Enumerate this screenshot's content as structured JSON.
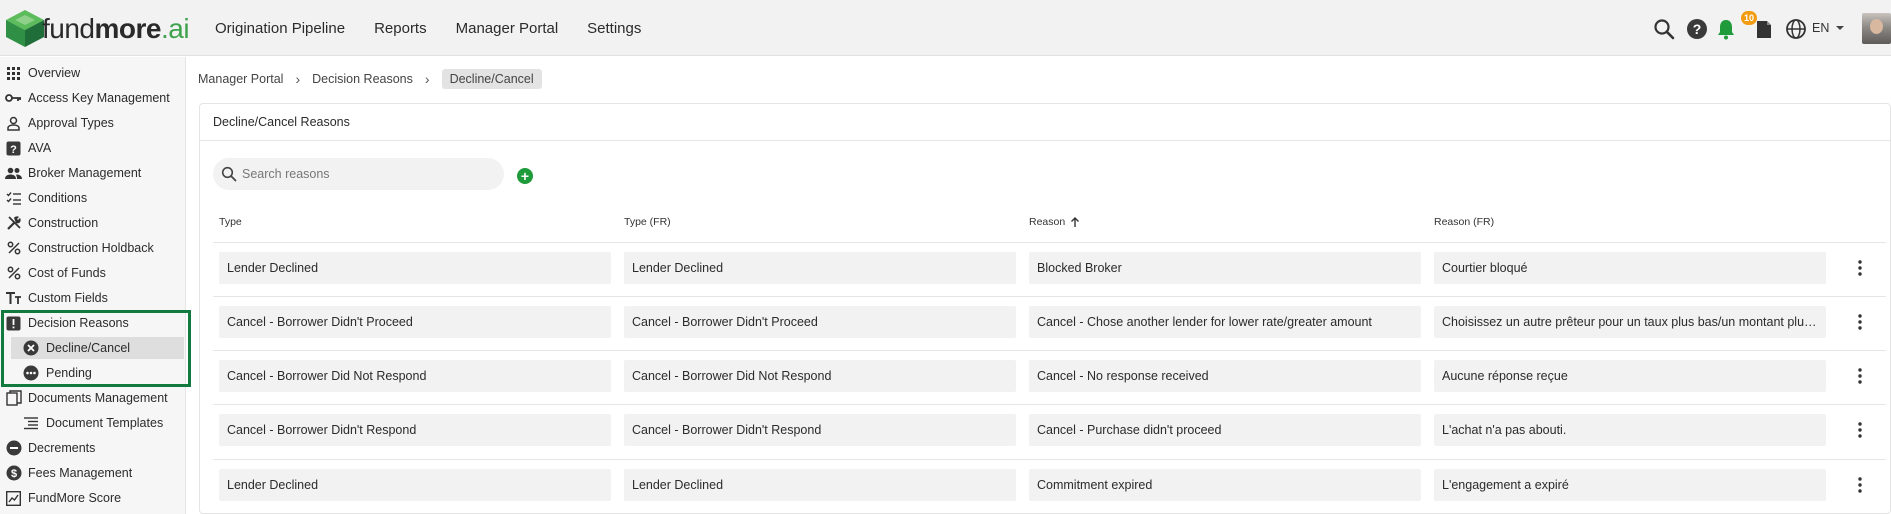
{
  "brand": {
    "name_light": "fund",
    "name_bold": "more",
    "name_suffix": ".ai",
    "accent": "#3fa34d",
    "highlight": "#127a3f"
  },
  "topnav": {
    "items": [
      "Origination Pipeline",
      "Reports",
      "Manager Portal",
      "Settings"
    ]
  },
  "topright": {
    "notification_count": "10",
    "language": "EN"
  },
  "sidebar": {
    "items": [
      {
        "label": "Overview",
        "icon": "grid-icon"
      },
      {
        "label": "Access Key Management",
        "icon": "key-icon"
      },
      {
        "label": "Approval Types",
        "icon": "person-icon"
      },
      {
        "label": "AVA",
        "icon": "question-box-icon"
      },
      {
        "label": "Broker Management",
        "icon": "people-icon"
      },
      {
        "label": "Conditions",
        "icon": "checklist-icon"
      },
      {
        "label": "Construction",
        "icon": "tools-icon"
      },
      {
        "label": "Construction Holdback",
        "icon": "percent-icon"
      },
      {
        "label": "Cost of Funds",
        "icon": "percent-icon"
      },
      {
        "label": "Custom Fields",
        "icon": "text-icon"
      },
      {
        "label": "Decision Reasons",
        "icon": "alert-box-icon"
      },
      {
        "label": "Decline/Cancel",
        "icon": "cancel-circle-icon"
      },
      {
        "label": "Pending",
        "icon": "more-circle-icon"
      },
      {
        "label": "Documents Management",
        "icon": "documents-icon"
      },
      {
        "label": "Document Templates",
        "icon": "list-icon"
      },
      {
        "label": "Decrements",
        "icon": "minus-circle-icon"
      },
      {
        "label": "Fees Management",
        "icon": "dollar-circle-icon"
      },
      {
        "label": "FundMore Score",
        "icon": "score-icon"
      }
    ]
  },
  "breadcrumb": {
    "items": [
      "Manager Portal",
      "Decision Reasons"
    ],
    "current": "Decline/Cancel"
  },
  "card": {
    "title": "Decline/Cancel Reasons"
  },
  "search": {
    "placeholder": "Search reasons"
  },
  "table": {
    "columns": [
      "Type",
      "Type (FR)",
      "Reason",
      "Reason (FR)"
    ],
    "sorted_column": "Reason",
    "sort_direction": "ascending",
    "rows": [
      [
        "Lender Declined",
        "Lender Declined",
        "Blocked Broker",
        "Courtier bloqué"
      ],
      [
        "Cancel - Borrower Didn't Proceed",
        "Cancel - Borrower Didn't Proceed",
        "Cancel - Chose another lender for lower rate/greater amount",
        "Choisissez un autre prêteur pour un taux plus bas/un montant plus élevé"
      ],
      [
        "Cancel - Borrower Did Not Respond",
        "Cancel - Borrower Did Not Respond",
        "Cancel - No response received",
        "Aucune réponse reçue"
      ],
      [
        "Cancel - Borrower Didn't Respond",
        "Cancel - Borrower Didn't Respond",
        "Cancel - Purchase didn't proceed",
        "L'achat n'a pas abouti."
      ],
      [
        "Lender Declined",
        "Lender Declined",
        "Commitment expired",
        "L'engagement a expiré"
      ]
    ]
  }
}
